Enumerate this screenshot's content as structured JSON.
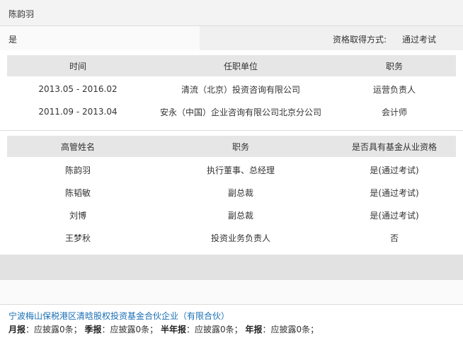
{
  "person": {
    "name": "陈韵羽"
  },
  "qualification": {
    "value": "是",
    "method_label": "资格取得方式:",
    "method_value": "通过考试"
  },
  "employment": {
    "headers": [
      "时间",
      "任职单位",
      "职务"
    ],
    "rows": [
      [
        "2013.05 - 2016.02",
        "清流（北京）投资咨询有限公司",
        "运营负责人"
      ],
      [
        "2011.09 - 2013.04",
        "安永（中国）企业咨询有限公司北京分公司",
        "会计师"
      ]
    ]
  },
  "executives": {
    "headers": [
      "高管姓名",
      "职务",
      "是否具有基金从业资格"
    ],
    "rows": [
      [
        "陈韵羽",
        "执行董事、总经理",
        "是(通过考试)"
      ],
      [
        "陈韬敏",
        "副总裁",
        "是(通过考试)"
      ],
      [
        "刘博",
        "副总裁",
        "是(通过考试)"
      ],
      [
        "王梦秋",
        "投资业务负责人",
        "否"
      ]
    ]
  },
  "fund": {
    "name": "宁波梅山保税港区清晗股权投资基金合伙企业（有限合伙）",
    "reports": [
      {
        "label": "月报",
        "text": "：应披露0条；"
      },
      {
        "label": "季报",
        "text": "：应披露0条；"
      },
      {
        "label": "半年报",
        "text": "：应披露0条；"
      },
      {
        "label": "年报",
        "text": "：应披露0条；"
      }
    ]
  }
}
